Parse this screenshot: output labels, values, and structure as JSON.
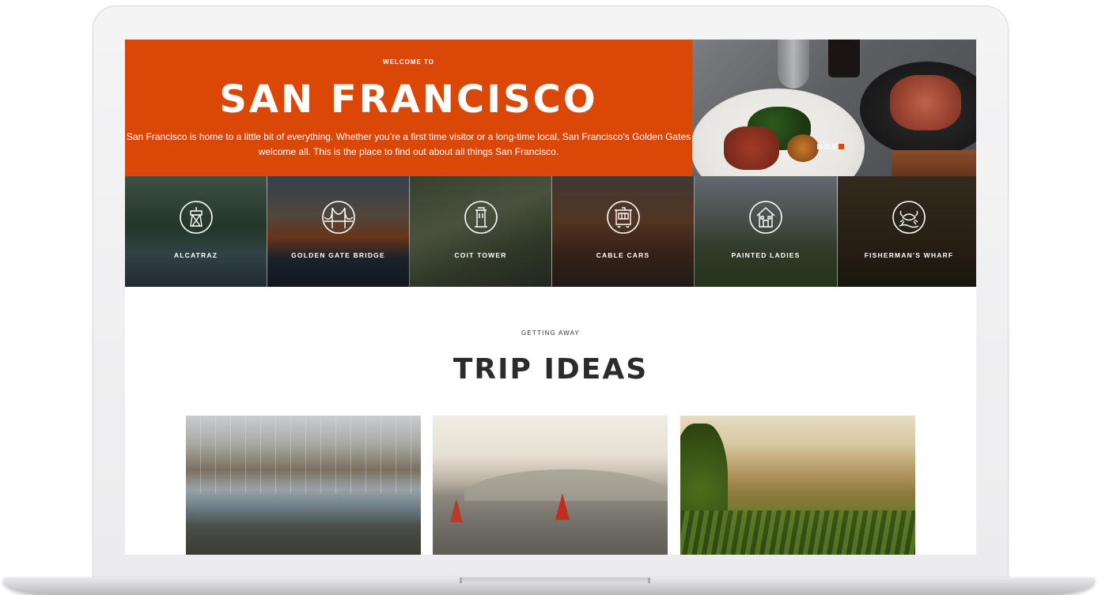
{
  "hero": {
    "kicker": "WELCOME TO",
    "title": "SAN FRANCISCO",
    "description": "San Francisco is home to a little bit of everything. Whether you’re a first time visitor or a long-time local, San Francisco's Golden Gates welcome all. This is the place to find out about all things San Francisco.",
    "brand_color": "#db4707"
  },
  "slider": {
    "dot_count": 4,
    "active_index": 3
  },
  "landmarks": [
    {
      "label": "ALCATRAZ",
      "icon": "lighthouse-tower-icon"
    },
    {
      "label": "GOLDEN GATE BRIDGE",
      "icon": "bridge-icon"
    },
    {
      "label": "COIT TOWER",
      "icon": "tower-icon"
    },
    {
      "label": "CABLE CARS",
      "icon": "cable-car-icon"
    },
    {
      "label": "PAINTED LADIES",
      "icon": "house-icon"
    },
    {
      "label": "FISHERMAN'S WHARF",
      "icon": "crab-icon"
    }
  ],
  "trip_section": {
    "kicker": "GETTING AWAY",
    "title": "TRIP IDEAS"
  }
}
